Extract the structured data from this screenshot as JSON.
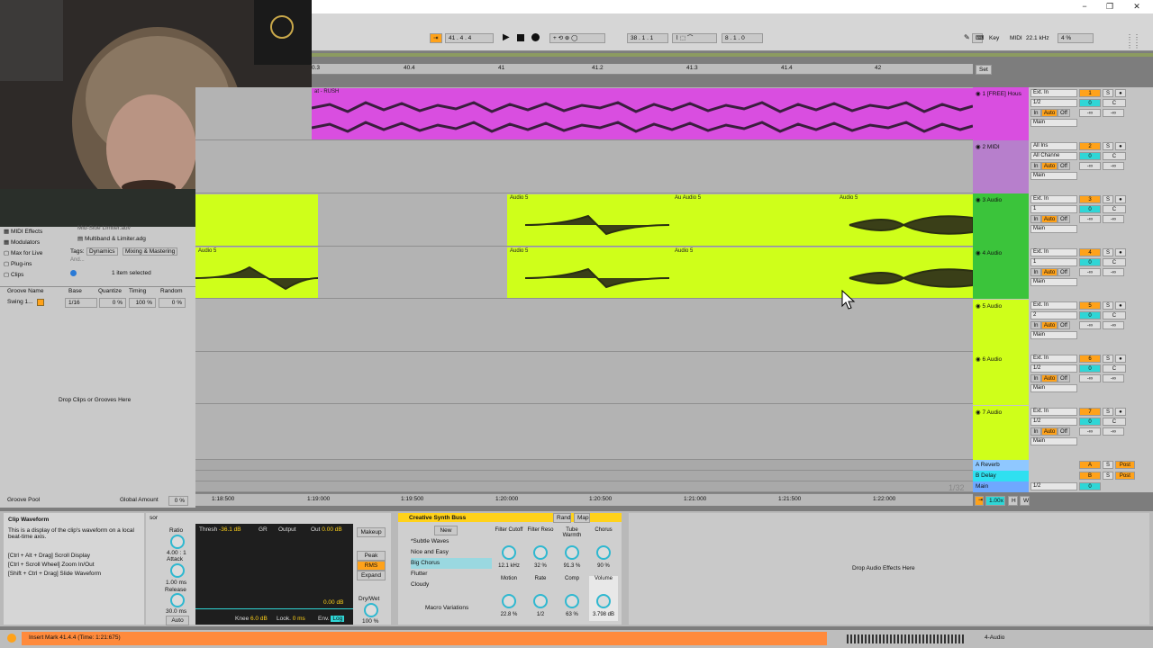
{
  "window": {
    "minimize": "−",
    "restore": "❐",
    "close": "✕"
  },
  "transport": {
    "position": "41 .  4 .  4",
    "loop_start": "38 .  1 .  1",
    "loop_length": "8 .  1 .  0",
    "key_label": "Key",
    "midi_label": "MIDI",
    "sample_rate": "22.1 kHz",
    "cpu": "4 %"
  },
  "ruler": {
    "ticks": [
      "0.3",
      "40.4",
      "41",
      "41.2",
      "41.3",
      "41.4",
      "42"
    ],
    "set_label": "Set"
  },
  "browser": {
    "categories": [
      {
        "icon": "midi-effects-icon",
        "label": "MIDI Effects"
      },
      {
        "icon": "modulators-icon",
        "label": "Modulators"
      },
      {
        "icon": "max-icon",
        "label": "Max for Live"
      },
      {
        "icon": "plugin-icon",
        "label": "Plug-ins"
      },
      {
        "icon": "clips-icon",
        "label": "Clips"
      }
    ],
    "files": [
      "Mid-Side Limiter.adv",
      "Multiband & Limiter.adg"
    ],
    "tags_label": "Tags:",
    "tags": [
      "Dynamics",
      "Mixing & Mastering"
    ],
    "tags_more": "And...",
    "selected_info": "1 item selected",
    "groove_headers": [
      "Groove Name",
      "Base",
      "Quantize",
      "Timing",
      "Random"
    ],
    "groove_row": {
      "name": "Swing 1...",
      "base": "1/16",
      "quantize": "0 %",
      "timing": "100 %",
      "random": "0 %"
    },
    "drop_text": "Drop Clips or Grooves Here",
    "groove_pool": "Groove Pool",
    "global_amount_label": "Global Amount",
    "global_amount": "0 %"
  },
  "tracks": [
    {
      "name": "1 [FREE] Hous",
      "input": "Ext. In",
      "channel": "1/2",
      "out": "Main",
      "num": "1",
      "vol": "0",
      "pan": "C",
      "color": "#d94ee0"
    },
    {
      "name": "2 MIDI",
      "input": "All Ins",
      "channel": "All Channe",
      "out": "Main",
      "num": "2",
      "vol": "0",
      "pan": "C",
      "color": "#b77fcc"
    },
    {
      "name": "3 Audio",
      "input": "Ext. In",
      "channel": "1",
      "out": "Main",
      "num": "3",
      "vol": "0",
      "pan": "C",
      "color": "#3bc43b"
    },
    {
      "name": "4 Audio",
      "input": "Ext. In",
      "channel": "1",
      "out": "Main",
      "num": "4",
      "vol": "0",
      "pan": "C",
      "color": "#3bc43b"
    },
    {
      "name": "5 Audio",
      "input": "Ext. In",
      "channel": "2",
      "out": "Main",
      "num": "5",
      "vol": "0",
      "pan": "C",
      "color": "#cfff1a"
    },
    {
      "name": "6 Audio",
      "input": "Ext. In",
      "channel": "1/2",
      "out": "Main",
      "num": "6",
      "vol": "0",
      "pan": "C",
      "color": "#cfff1a"
    },
    {
      "name": "7 Audio",
      "input": "Ext. In",
      "channel": "1/2",
      "out": "Main",
      "num": "7",
      "vol": "0",
      "pan": "C",
      "color": "#cfff1a"
    }
  ],
  "monitor": {
    "in": "In",
    "auto": "Auto",
    "off": "Off",
    "inf": "-∞"
  },
  "returns": [
    {
      "name": "A Reverb",
      "letter": "A",
      "post": "Post"
    },
    {
      "name": "B Delay",
      "letter": "B",
      "post": "Post"
    }
  ],
  "main_track": {
    "name": "Main",
    "channel": "1/2",
    "vol": "0"
  },
  "clips": {
    "track1": "at - RUSH",
    "audio5": "Audio 5",
    "audio5_short": "Au"
  },
  "timeline": {
    "times": [
      "1:18:500",
      "1:19:000",
      "1:19:500",
      "1:20:000",
      "1:20:500",
      "1:21:000",
      "1:21:500",
      "1:22:000"
    ],
    "quantize": "1/32",
    "zoom": "1.00x"
  },
  "info": {
    "title": "Clip Waveform",
    "body": "This is a display of the clip's waveform on a local beat-time axis.",
    "hints": [
      "[Ctrl + Alt + Drag] Scroll Display",
      "[Ctrl + Scroll Wheel] Zoom In/Out",
      "[Shift + Ctrl + Drag] Slide Waveform"
    ]
  },
  "compressor": {
    "title_fragment": "sor",
    "ratio_label": "Ratio",
    "ratio": "4.00 : 1",
    "attack_label": "Attack",
    "attack": "1.00 ms",
    "release_label": "Release",
    "release": "30.0 ms",
    "auto": "Auto",
    "thresh_label": "Thresh",
    "thresh": "-36.1 dB",
    "gr": "GR",
    "output_label": "Output",
    "out_label": "Out",
    "out": "0.00 dB",
    "makeup": "Makeup",
    "peak": "Peak",
    "rms": "RMS",
    "expand": "Expand",
    "meter_value": "0.00 dB",
    "drywet_label": "Dry/Wet",
    "drywet": "100 %",
    "knee_label": "Knee",
    "knee": "6.0 dB",
    "look_label": "Look.",
    "look": "0 ms",
    "env_label": "Env.",
    "env": "Log"
  },
  "rack": {
    "title": "Creative Synth Buss",
    "rand": "Rand",
    "map": "Map",
    "new": "New",
    "presets": [
      "*Subtle Waves",
      "Nice and Easy",
      "Big Chorus",
      "Flutter",
      "Cloudy"
    ],
    "macro_variations": "Macro Variations",
    "macros": [
      {
        "label": "Filter Cutoff",
        "value": "12.1 kHz"
      },
      {
        "label": "Filter Reso",
        "value": "32 %"
      },
      {
        "label": "Tube Warmth",
        "value": "91.3 %"
      },
      {
        "label": "Chorus",
        "value": "90 %"
      },
      {
        "label": "Motion",
        "value": "22.8 %"
      },
      {
        "label": "Rate",
        "value": "1/2"
      },
      {
        "label": "Comp",
        "value": "63 %"
      },
      {
        "label": "Volume",
        "value": "3.798 dB"
      }
    ]
  },
  "drop_effects": "Drop Audio Effects Here",
  "status": {
    "message": "Insert Mark 41.4.4 (Time: 1:21:675)",
    "track": "4-Audio"
  },
  "colors": {
    "accent": "#ffa21a",
    "clip_green": "#cfff1a",
    "clip_pink": "#d94ee0",
    "knob": "#2fb8d0"
  }
}
